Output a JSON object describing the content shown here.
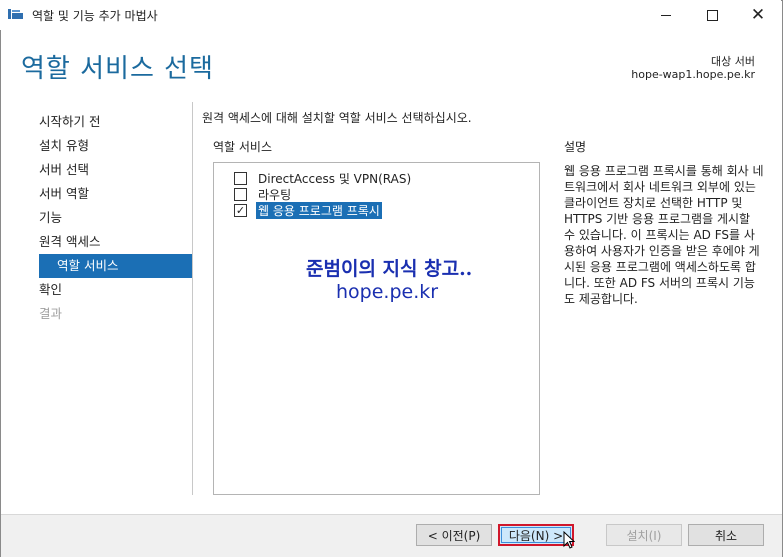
{
  "window": {
    "title": "역할 및 기능 추가 마법사",
    "controls": {
      "minimize_icon": "minimize-icon",
      "maximize_icon": "maximize-icon",
      "close_glyph": "✕"
    }
  },
  "header": {
    "title": "역할 서비스 선택",
    "destination_label": "대상 서버",
    "destination_value": "hope-wap1.hope.pe.kr"
  },
  "nav": {
    "items": [
      {
        "label": "시작하기 전",
        "state": "normal"
      },
      {
        "label": "설치 유형",
        "state": "normal"
      },
      {
        "label": "서버 선택",
        "state": "normal"
      },
      {
        "label": "서버 역할",
        "state": "normal"
      },
      {
        "label": "기능",
        "state": "normal"
      },
      {
        "label": "원격 액세스",
        "state": "normal"
      },
      {
        "label": "역할 서비스",
        "state": "active"
      },
      {
        "label": "확인",
        "state": "normal"
      },
      {
        "label": "결과",
        "state": "disabled"
      }
    ]
  },
  "content": {
    "instruction": "원격 액세스에 대해 설치할 역할 서비스 선택하십시오.",
    "services_heading": "역할 서비스",
    "services": [
      {
        "label": "DirectAccess 및 VPN(RAS)",
        "checked": false,
        "selected": false
      },
      {
        "label": "라우팅",
        "checked": false,
        "selected": false
      },
      {
        "label": "웹 응용 프로그램 프록시",
        "checked": true,
        "selected": true
      }
    ],
    "watermark_title": "준범이의 지식 창고..",
    "watermark_url": "hope.pe.kr",
    "description_heading": "설명",
    "description": "웹 응용 프로그램 프록시를 통해 회사 네트워크에서 회사 네트워크 외부에 있는 클라이언트 장치로 선택한 HTTP 및 HTTPS 기반 응용 프로그램을 게시할 수 있습니다. 이 프록시는 AD FS를 사용하여 사용자가 인증을 받은 후에야 게시된 응용 프로그램에 액세스하도록 합니다. 또한 AD FS 서버의 프록시 기능도 제공합니다."
  },
  "footer": {
    "prev_label": "< 이전(P)",
    "next_label": "다음(N) >",
    "install_label": "설치(I)",
    "cancel_label": "취소"
  },
  "colors": {
    "accent": "#1b6fb5",
    "title": "#1b6a9e",
    "highlight_border": "#d0172b",
    "watermark": "#1a2fb0"
  }
}
